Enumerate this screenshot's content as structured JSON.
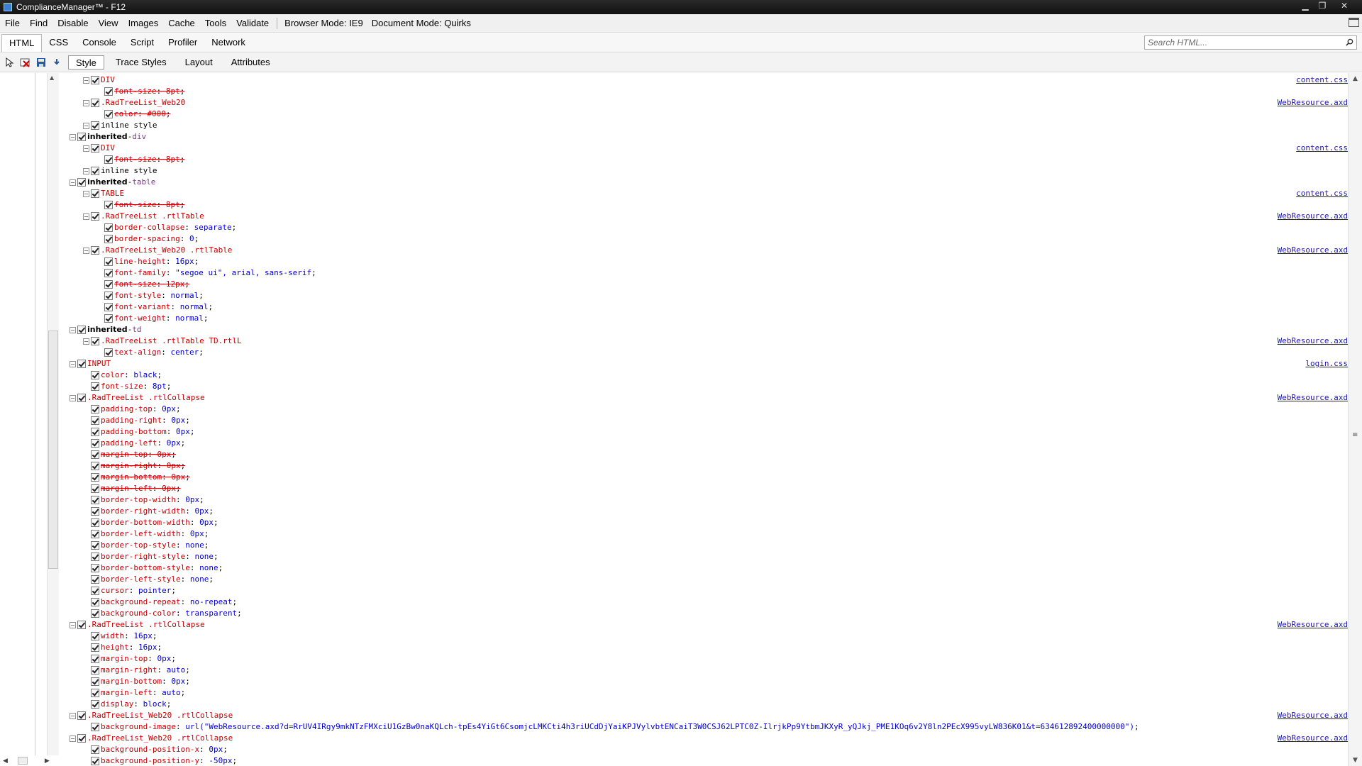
{
  "window": {
    "title": "ComplianceManager™ - F12",
    "minimize": "▁",
    "restore": "❐",
    "close": "✕"
  },
  "menu": {
    "items": [
      "File",
      "Find",
      "Disable",
      "View",
      "Images",
      "Cache",
      "Tools",
      "Validate"
    ],
    "browser_mode": "Browser Mode: IE9",
    "document_mode": "Document Mode: Quirks"
  },
  "tabs": [
    "HTML",
    "CSS",
    "Console",
    "Script",
    "Profiler",
    "Network"
  ],
  "search": {
    "placeholder": "Search HTML..."
  },
  "subtabs": [
    "Style",
    "Trace Styles",
    "Layout",
    "Attributes"
  ],
  "rules": [
    {
      "indent": 1,
      "type": "rule",
      "selector": "DIV",
      "color": "red",
      "source": "content.css"
    },
    {
      "indent": 2,
      "type": "decl",
      "prop": "font-size",
      "value": "8pt",
      "struck": true
    },
    {
      "indent": 1,
      "type": "rule",
      "selector": ".RadTreeList_Web20",
      "color": "red",
      "source": "WebResource.axd"
    },
    {
      "indent": 2,
      "type": "decl",
      "prop": "color",
      "value": "#000",
      "struck": true
    },
    {
      "indent": 1,
      "type": "rule",
      "selector": "inline style",
      "color": "black"
    },
    {
      "indent": 0,
      "type": "inherited",
      "label": "inherited",
      "element": "div"
    },
    {
      "indent": 1,
      "type": "rule",
      "selector": "DIV",
      "color": "red",
      "source": "content.css"
    },
    {
      "indent": 2,
      "type": "decl",
      "prop": "font-size",
      "value": "8pt",
      "struck": true
    },
    {
      "indent": 1,
      "type": "rule",
      "selector": "inline style",
      "color": "black"
    },
    {
      "indent": 0,
      "type": "inherited",
      "label": "inherited",
      "element": "table"
    },
    {
      "indent": 1,
      "type": "rule",
      "selector": "TABLE",
      "color": "red",
      "source": "content.css"
    },
    {
      "indent": 2,
      "type": "decl",
      "prop": "font-size",
      "value": "8pt",
      "struck": true
    },
    {
      "indent": 1,
      "type": "rule",
      "selector": ".RadTreeList .rtlTable",
      "color": "red",
      "source": "WebResource.axd"
    },
    {
      "indent": 2,
      "type": "decl",
      "prop": "border-collapse",
      "value": "separate"
    },
    {
      "indent": 2,
      "type": "decl",
      "prop": "border-spacing",
      "value": "0"
    },
    {
      "indent": 1,
      "type": "rule",
      "selector": ".RadTreeList_Web20 .rtlTable",
      "color": "red",
      "source": "WebResource.axd"
    },
    {
      "indent": 2,
      "type": "decl",
      "prop": "line-height",
      "value": "16px"
    },
    {
      "indent": 2,
      "type": "decl",
      "prop": "font-family",
      "value": "\"segoe ui\", arial, sans-serif"
    },
    {
      "indent": 2,
      "type": "decl",
      "prop": "font-size",
      "value": "12px",
      "struck": true
    },
    {
      "indent": 2,
      "type": "decl",
      "prop": "font-style",
      "value": "normal"
    },
    {
      "indent": 2,
      "type": "decl",
      "prop": "font-variant",
      "value": "normal"
    },
    {
      "indent": 2,
      "type": "decl",
      "prop": "font-weight",
      "value": "normal"
    },
    {
      "indent": 0,
      "type": "inherited",
      "label": "inherited",
      "element": "td"
    },
    {
      "indent": 1,
      "type": "rule",
      "selector": ".RadTreeList .rtlTable TD.rtlL",
      "color": "red",
      "source": "WebResource.axd"
    },
    {
      "indent": 2,
      "type": "decl",
      "prop": "text-align",
      "value": "center"
    },
    {
      "indent": 0,
      "type": "rule",
      "selector": "INPUT",
      "color": "red",
      "source": "login.css"
    },
    {
      "indent": 1,
      "type": "decl",
      "prop": "color",
      "value": "black"
    },
    {
      "indent": 1,
      "type": "decl",
      "prop": "font-size",
      "value": "8pt"
    },
    {
      "indent": 0,
      "type": "rule",
      "selector": ".RadTreeList .rtlCollapse",
      "color": "red",
      "source": "WebResource.axd"
    },
    {
      "indent": 1,
      "type": "decl",
      "prop": "padding-top",
      "value": "0px"
    },
    {
      "indent": 1,
      "type": "decl",
      "prop": "padding-right",
      "value": "0px"
    },
    {
      "indent": 1,
      "type": "decl",
      "prop": "padding-bottom",
      "value": "0px"
    },
    {
      "indent": 1,
      "type": "decl",
      "prop": "padding-left",
      "value": "0px"
    },
    {
      "indent": 1,
      "type": "decl",
      "prop": "margin-top",
      "value": "0px",
      "struck": true
    },
    {
      "indent": 1,
      "type": "decl",
      "prop": "margin-right",
      "value": "0px",
      "struck": true
    },
    {
      "indent": 1,
      "type": "decl",
      "prop": "margin-bottom",
      "value": "0px",
      "struck": true
    },
    {
      "indent": 1,
      "type": "decl",
      "prop": "margin-left",
      "value": "0px",
      "struck": true
    },
    {
      "indent": 1,
      "type": "decl",
      "prop": "border-top-width",
      "value": "0px"
    },
    {
      "indent": 1,
      "type": "decl",
      "prop": "border-right-width",
      "value": "0px"
    },
    {
      "indent": 1,
      "type": "decl",
      "prop": "border-bottom-width",
      "value": "0px"
    },
    {
      "indent": 1,
      "type": "decl",
      "prop": "border-left-width",
      "value": "0px"
    },
    {
      "indent": 1,
      "type": "decl",
      "prop": "border-top-style",
      "value": "none"
    },
    {
      "indent": 1,
      "type": "decl",
      "prop": "border-right-style",
      "value": "none"
    },
    {
      "indent": 1,
      "type": "decl",
      "prop": "border-bottom-style",
      "value": "none"
    },
    {
      "indent": 1,
      "type": "decl",
      "prop": "border-left-style",
      "value": "none"
    },
    {
      "indent": 1,
      "type": "decl",
      "prop": "cursor",
      "value": "pointer"
    },
    {
      "indent": 1,
      "type": "decl",
      "prop": "background-repeat",
      "value": "no-repeat"
    },
    {
      "indent": 1,
      "type": "decl",
      "prop": "background-color",
      "value": "transparent"
    },
    {
      "indent": 0,
      "type": "rule",
      "selector": ".RadTreeList .rtlCollapse",
      "color": "red",
      "source": "WebResource.axd"
    },
    {
      "indent": 1,
      "type": "decl",
      "prop": "width",
      "value": "16px"
    },
    {
      "indent": 1,
      "type": "decl",
      "prop": "height",
      "value": "16px"
    },
    {
      "indent": 1,
      "type": "decl",
      "prop": "margin-top",
      "value": "0px"
    },
    {
      "indent": 1,
      "type": "decl",
      "prop": "margin-right",
      "value": "auto"
    },
    {
      "indent": 1,
      "type": "decl",
      "prop": "margin-bottom",
      "value": "0px"
    },
    {
      "indent": 1,
      "type": "decl",
      "prop": "margin-left",
      "value": "auto"
    },
    {
      "indent": 1,
      "type": "decl",
      "prop": "display",
      "value": "block"
    },
    {
      "indent": 0,
      "type": "rule",
      "selector": ".RadTreeList_Web20 .rtlCollapse",
      "color": "red",
      "source": "WebResource.axd"
    },
    {
      "indent": 1,
      "type": "decl",
      "prop": "background-image",
      "value": "url(\"WebResource.axd?d=RrUV4IRgy9mkNTzFMXciU1GzBw0naKQLch-tpEs4YiGt6CsomjcLMKCti4h3riUCdDjYaiKPJVylvbtENCaiT3W0CSJ62LPTC0Z-IlrjkPp9YtbmJKXyR_yQJkj_PME1KOq6v2Y8ln2PEcX995vyLW836K01&t=634612892400000000\")"
    },
    {
      "indent": 0,
      "type": "rule",
      "selector": ".RadTreeList_Web20 .rtlCollapse",
      "color": "red",
      "source": "WebResource.axd"
    },
    {
      "indent": 1,
      "type": "decl",
      "prop": "background-position-x",
      "value": "0px"
    },
    {
      "indent": 1,
      "type": "decl",
      "prop": "background-position-y",
      "value": "-50px"
    }
  ]
}
